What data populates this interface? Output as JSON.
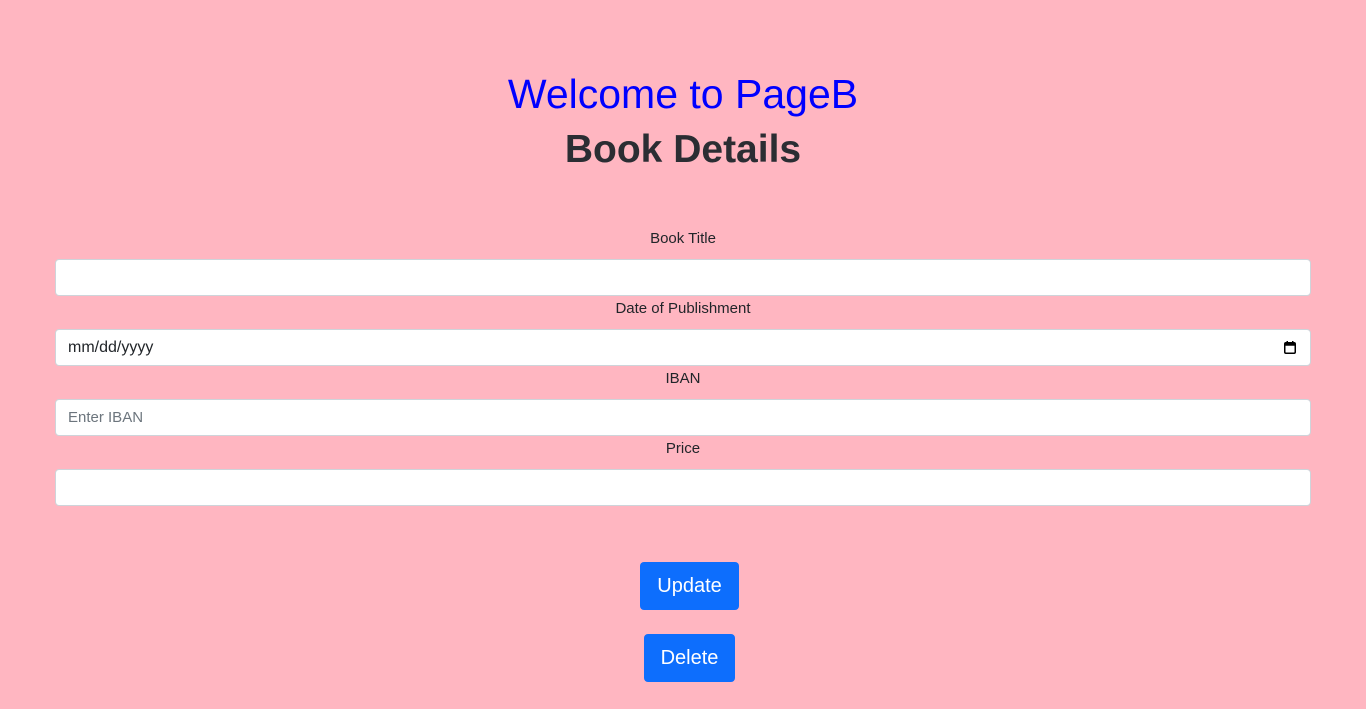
{
  "header": {
    "welcome": "Welcome to PageB",
    "title": "Book Details"
  },
  "form": {
    "fields": [
      {
        "label": "Book Title",
        "value": "",
        "placeholder": ""
      },
      {
        "label": "Date of Publishment",
        "value": "mm/dd/yyyy",
        "placeholder": ""
      },
      {
        "label": "IBAN",
        "value": "",
        "placeholder": "Enter IBAN"
      },
      {
        "label": "Price",
        "value": "",
        "placeholder": ""
      }
    ]
  },
  "actions": {
    "update_label": "Update",
    "delete_label": "Delete"
  },
  "colors": {
    "background": "#ffb6c1",
    "welcome": "#0000ff",
    "button": "#0d6efd"
  },
  "icons": {
    "date_picker": "calendar-icon"
  }
}
